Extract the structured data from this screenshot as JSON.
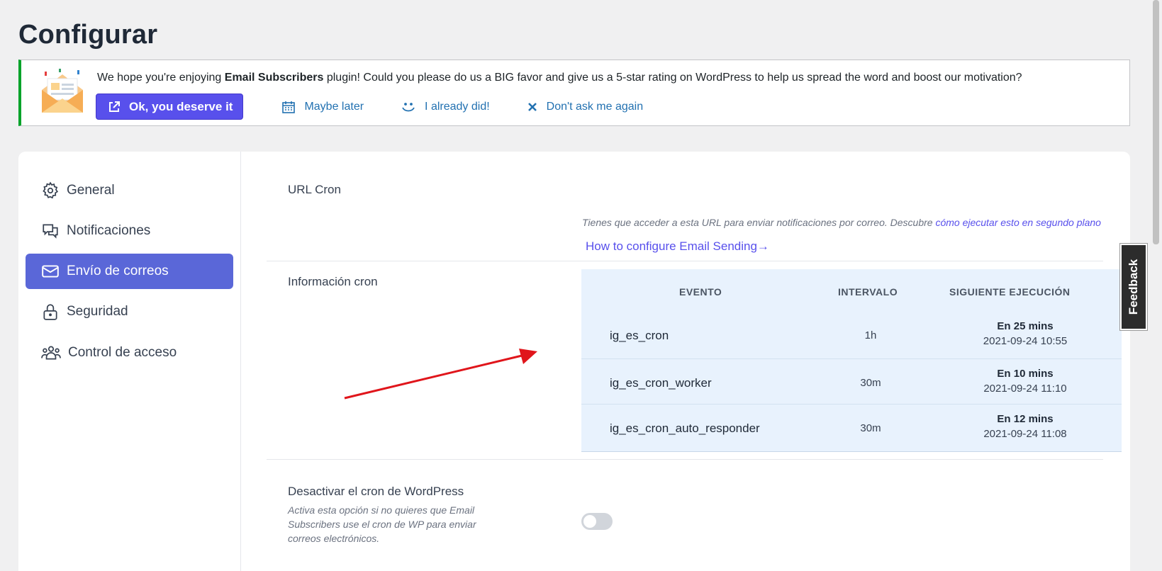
{
  "page": {
    "title": "Configurar"
  },
  "notice": {
    "text_before": "We hope you're enjoying ",
    "plugin_name": "Email Subscribers",
    "text_after": " plugin! Could you please do us a BIG favor and give us a 5-star rating on WordPress to help us spread the word and boost our motivation?",
    "primary_button": "Ok, you deserve it",
    "maybe_later": "Maybe later",
    "already_did": "I already did!",
    "dont_ask": "Don't ask me again"
  },
  "sidebar": {
    "items": [
      {
        "label": "General",
        "icon": "gear-icon"
      },
      {
        "label": "Notificaciones",
        "icon": "chat-icon"
      },
      {
        "label": "Envío de correos",
        "icon": "mail-icon",
        "active": true
      },
      {
        "label": "Seguridad",
        "icon": "lock-icon"
      },
      {
        "label": "Control de acceso",
        "icon": "users-icon"
      }
    ]
  },
  "cron_url": {
    "label": "URL Cron",
    "description": "Tienes que acceder a esta URL para enviar notificaciones por correo. Descubre ",
    "description_link": "cómo ejecutar esto en segundo plano",
    "config_link": "How to configure Email Sending→"
  },
  "cron_info": {
    "label": "Información cron",
    "headers": [
      "EVENTO",
      "INTERVALO",
      "SIGUIENTE EJECUCIÓN"
    ],
    "rows": [
      {
        "event": "ig_es_cron",
        "interval": "1h",
        "next_relative": "En 25 mins",
        "next_time": "2021-09-24 10:55"
      },
      {
        "event": "ig_es_cron_worker",
        "interval": "30m",
        "next_relative": "En 10 mins",
        "next_time": "2021-09-24 11:10"
      },
      {
        "event": "ig_es_cron_auto_responder",
        "interval": "30m",
        "next_relative": "En 12 mins",
        "next_time": "2021-09-24 11:08"
      }
    ]
  },
  "disable_wp_cron": {
    "label": "Desactivar el cron de WordPress",
    "description": "Activa esta opción si no quieres que Email Subscribers use el cron de WP para enviar correos electrónicos.",
    "enabled": false
  },
  "feedback": {
    "label": "Feedback"
  },
  "colors": {
    "accent": "#5850ec",
    "active_nav": "#5a67d8",
    "notice_border": "#00a32a",
    "link": "#2271b1",
    "annotation_arrow": "#e0151b"
  }
}
